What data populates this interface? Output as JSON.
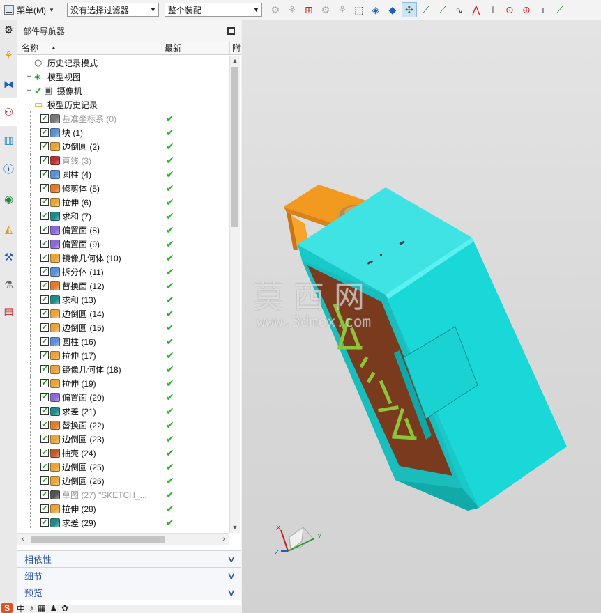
{
  "toolbar": {
    "menu_label": "菜单(M)",
    "filter_value": "没有选择过滤器",
    "scope_value": "整个装配"
  },
  "navigator": {
    "title": "部件导航器",
    "col_name": "名称",
    "col_newest": "最新",
    "col_dep": "附",
    "top_items": [
      {
        "label": "历史记录模式",
        "icon": "clock-icon",
        "expander": ""
      },
      {
        "label": "模型视图",
        "icon": "model-views-icon",
        "expander": "+"
      },
      {
        "label": "摄像机",
        "icon": "camera-icon",
        "expander": "+"
      },
      {
        "label": "模型历史记录",
        "icon": "folder-open-icon",
        "expander": "−"
      }
    ],
    "features": [
      {
        "label": "基准坐标系 (0)",
        "icon": "datum-csys-icon",
        "color": "#777777",
        "dim": true
      },
      {
        "label": "块 (1)",
        "icon": "block-icon",
        "color": "#5b8fd6",
        "dim": false
      },
      {
        "label": "边倒圆 (2)",
        "icon": "edge-blend-icon",
        "color": "#e8a33a",
        "dim": false
      },
      {
        "label": "直线 (3)",
        "icon": "line-icon",
        "color": "#c03030",
        "dim": true
      },
      {
        "label": "圆柱 (4)",
        "icon": "cylinder-icon",
        "color": "#5b8fd6",
        "dim": false
      },
      {
        "label": "修剪体 (5)",
        "icon": "trim-body-icon",
        "color": "#e07b2a",
        "dim": false
      },
      {
        "label": "拉伸 (6)",
        "icon": "extrude-icon",
        "color": "#e8a33a",
        "dim": false
      },
      {
        "label": "求和 (7)",
        "icon": "unite-icon",
        "color": "#1e8a8a",
        "dim": false
      },
      {
        "label": "偏置面 (8)",
        "icon": "offset-face-icon",
        "color": "#8a6ad6",
        "dim": false
      },
      {
        "label": "偏置面 (9)",
        "icon": "offset-face-icon",
        "color": "#8a6ad6",
        "dim": false
      },
      {
        "label": "镜像几何体 (10)",
        "icon": "mirror-geometry-icon",
        "color": "#e8a33a",
        "dim": false
      },
      {
        "label": "拆分体 (11)",
        "icon": "split-body-icon",
        "color": "#5b8fd6",
        "dim": false
      },
      {
        "label": "替换面 (12)",
        "icon": "replace-face-icon",
        "color": "#e07b2a",
        "dim": false
      },
      {
        "label": "求和 (13)",
        "icon": "unite-icon",
        "color": "#1e8a8a",
        "dim": false
      },
      {
        "label": "边倒圆 (14)",
        "icon": "edge-blend-icon",
        "color": "#e8a33a",
        "dim": false
      },
      {
        "label": "边倒圆 (15)",
        "icon": "edge-blend-icon",
        "color": "#e8a33a",
        "dim": false
      },
      {
        "label": "圆柱 (16)",
        "icon": "cylinder-icon",
        "color": "#5b8fd6",
        "dim": false
      },
      {
        "label": "拉伸 (17)",
        "icon": "extrude-icon",
        "color": "#e8a33a",
        "dim": false
      },
      {
        "label": "镜像几何体 (18)",
        "icon": "mirror-geometry-icon",
        "color": "#e8a33a",
        "dim": false
      },
      {
        "label": "拉伸 (19)",
        "icon": "extrude-icon",
        "color": "#e8a33a",
        "dim": false
      },
      {
        "label": "偏置面 (20)",
        "icon": "offset-face-icon",
        "color": "#8a6ad6",
        "dim": false
      },
      {
        "label": "求差 (21)",
        "icon": "subtract-icon",
        "color": "#1e8a8a",
        "dim": false
      },
      {
        "label": "替换面 (22)",
        "icon": "replace-face-icon",
        "color": "#e07b2a",
        "dim": false
      },
      {
        "label": "边倒圆 (23)",
        "icon": "edge-blend-icon",
        "color": "#e8a33a",
        "dim": false
      },
      {
        "label": "抽壳 (24)",
        "icon": "shell-icon",
        "color": "#c05a2a",
        "dim": false
      },
      {
        "label": "边倒圆 (25)",
        "icon": "edge-blend-icon",
        "color": "#e8a33a",
        "dim": false
      },
      {
        "label": "边倒圆 (26)",
        "icon": "edge-blend-icon",
        "color": "#e8a33a",
        "dim": false
      },
      {
        "label": "草图 (27) \"SKETCH_...",
        "icon": "sketch-icon",
        "color": "#555555",
        "dim": true
      },
      {
        "label": "拉伸 (28)",
        "icon": "extrude-icon",
        "color": "#e8a33a",
        "dim": false
      },
      {
        "label": "求差 (29)",
        "icon": "subtract-icon",
        "color": "#1e8a8a",
        "dim": false
      }
    ],
    "sections": [
      "相依性",
      "细节",
      "预览"
    ]
  },
  "viewport": {
    "watermark_big": "莫西网",
    "watermark_small": "www.3dmox.com",
    "triad": {
      "x": "X",
      "y": "Y",
      "z": "Z"
    },
    "model_colors": {
      "body": "#19d6d6",
      "display": "#7a3a1e",
      "digits": "#8cc43a",
      "handle": "#f29a1f"
    },
    "display_text": "10:10"
  },
  "ime_bar": {
    "logo": "S",
    "mode": "中"
  }
}
